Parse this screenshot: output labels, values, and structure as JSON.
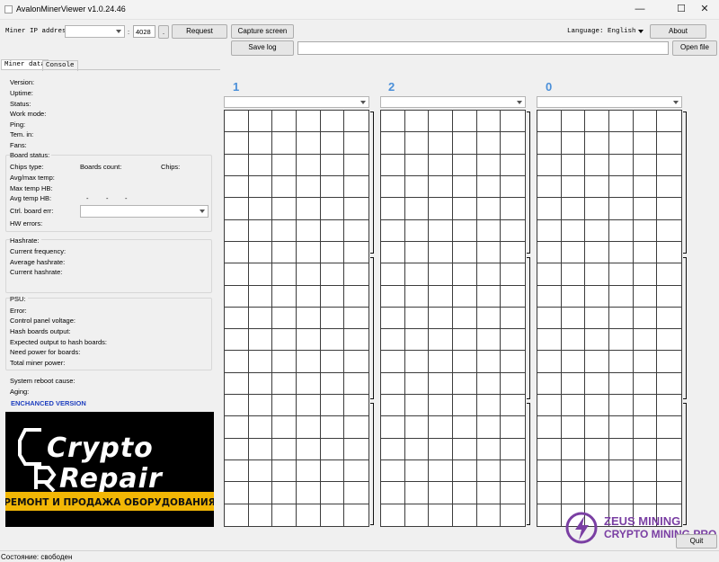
{
  "window": {
    "title": "AvalonMinerViewer v1.0.24.46",
    "controls": [
      "—",
      "☐",
      "✕"
    ]
  },
  "toolbar": {
    "ip_label": "Miner IP address:",
    "ip_value": "",
    "port_sep": ":",
    "port_value": "4028",
    "dot_button": ".",
    "request": "Request",
    "capture": "Capture screen",
    "save_log": "Save log",
    "log_path": "",
    "language_label": "Language:",
    "language_value": "English",
    "about": "About",
    "open_file": "Open file"
  },
  "tabs": [
    "Miner data",
    "Console"
  ],
  "miner_info": {
    "version": "Version:",
    "uptime": "Uptime:",
    "status": "Status:",
    "work_mode": "Work mode:",
    "ping": "Ping:",
    "tem_in": "Tem. in:",
    "fans": "Fans:"
  },
  "board_status": {
    "title": "Board status:",
    "chips_type": "Chips type:",
    "boards_count": "Boards count:",
    "chips": "Chips:",
    "avg_max_temp": "Avg/max temp:",
    "max_temp_hb": "Max temp HB:",
    "avg_temp_hb": "Avg temp HB:",
    "dash_values": [
      "-",
      "-",
      "-"
    ],
    "ctrl_board_err": "Ctrl. board err:",
    "ctrl_board_err_value": "",
    "hw_errors": "HW errors:"
  },
  "hashrate": {
    "title": "Hashrate:",
    "current_frequency": "Current frequency:",
    "average_hashrate": "Average hashrate:",
    "current_hashrate": "Current hashrate:"
  },
  "psu": {
    "title": "PSU:",
    "error": "Error:",
    "control_panel_voltage": "Control panel voltage:",
    "hash_boards_output": "Hash boards output:",
    "expected_output": "Expected output to hash boards:",
    "need_power": "Need power for boards:",
    "total_power": "Total miner power:"
  },
  "system": {
    "reboot_cause": "System reboot cause:",
    "aging": "Aging:",
    "enhanced": "ENCHANCED VERSION",
    "enhanced_color": "#1f3fbf"
  },
  "ad": {
    "logo_line1": "Crypto",
    "logo_line2": "Repair",
    "banner": "РЕМОНТ И ПРОДАЖА ОБОРУДОВАНИЯ",
    "banner_color": "#f2b705"
  },
  "boards": [
    {
      "number": "1",
      "selected": ""
    },
    {
      "number": "2",
      "selected": ""
    },
    {
      "number": "0",
      "selected": ""
    }
  ],
  "watermark": {
    "line1": "ZEUS MINING",
    "line2": "CRYPTO MINING PRO",
    "color": "#7a3fa3"
  },
  "quit": "Quit",
  "statusbar": {
    "text": "Состояние: свободен"
  }
}
